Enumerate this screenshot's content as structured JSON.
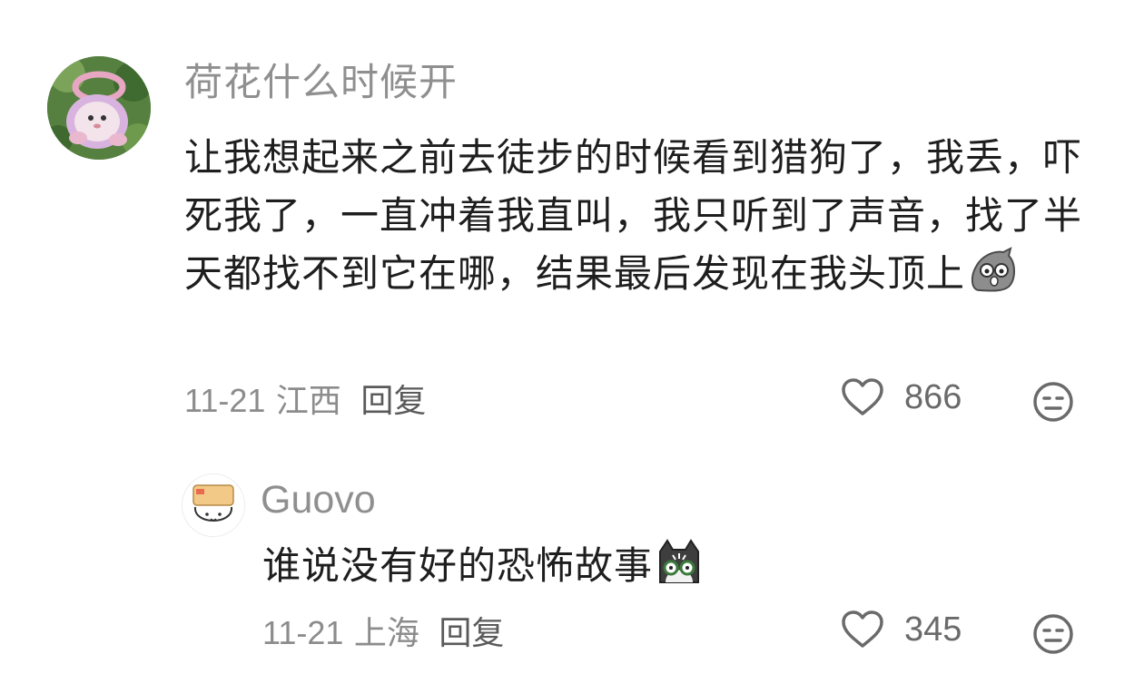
{
  "comments": [
    {
      "username": "荷花什么时候开",
      "content": "让我想起来之前去徒步的时候看到猎狗了，我丢，吓死我了，一直冲着我直叫，我只听到了声音，找了半天都找不到它在哪，结果最后发现在我头顶上",
      "emoji_icon": "scared-bird-emoji",
      "date": "11-21",
      "location": "江西",
      "reply_label": "回复",
      "likes": "866"
    },
    {
      "username": "Guovo",
      "content": "谁说没有好的恐怖故事",
      "emoji_icon": "shocked-cat-emoji",
      "date": "11-21",
      "location": "上海",
      "reply_label": "回复",
      "likes": "345"
    }
  ],
  "colors": {
    "username": "#8f8f8f",
    "content": "#1e1e1e",
    "meta": "#8c8c8c",
    "icon": "#6a6a6a"
  }
}
